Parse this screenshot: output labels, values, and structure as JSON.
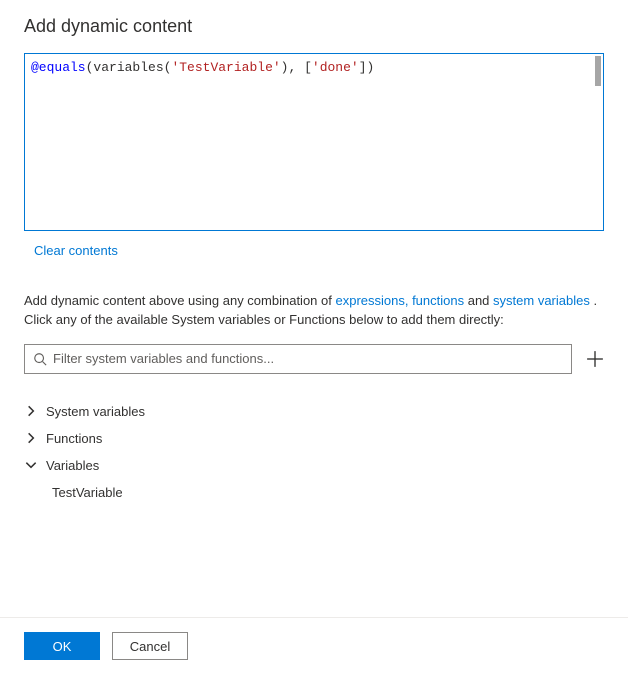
{
  "title": "Add dynamic content",
  "expression": {
    "display_raw": "@equals(variables('TestVariable'), ['done'])",
    "tokens": [
      {
        "t": "@equals",
        "c": "tok-at"
      },
      {
        "t": "(",
        "c": "tok-paren"
      },
      {
        "t": "variables",
        "c": "tok-fn"
      },
      {
        "t": "(",
        "c": "tok-paren"
      },
      {
        "t": "'TestVariable'",
        "c": "tok-str"
      },
      {
        "t": ")",
        "c": "tok-paren"
      },
      {
        "t": ", ",
        "c": "tok-comma"
      },
      {
        "t": "[",
        "c": "tok-bracket"
      },
      {
        "t": "'done'",
        "c": "tok-str"
      },
      {
        "t": "]",
        "c": "tok-bracket"
      },
      {
        "t": ")",
        "c": "tok-paren"
      }
    ]
  },
  "clear_label": "Clear contents",
  "help": {
    "prefix": "Add dynamic content above using any combination of ",
    "link1": "expressions, functions",
    "middle": " and ",
    "link2": "system variables",
    "suffix1": " . ",
    "line2": "Click any of the available System variables or Functions below to add them directly:"
  },
  "filter": {
    "placeholder": "Filter system variables and functions..."
  },
  "tree": {
    "groups": [
      {
        "label": "System variables",
        "expanded": false,
        "children": []
      },
      {
        "label": "Functions",
        "expanded": false,
        "children": []
      },
      {
        "label": "Variables",
        "expanded": true,
        "children": [
          "TestVariable"
        ]
      }
    ]
  },
  "footer": {
    "ok": "OK",
    "cancel": "Cancel"
  }
}
